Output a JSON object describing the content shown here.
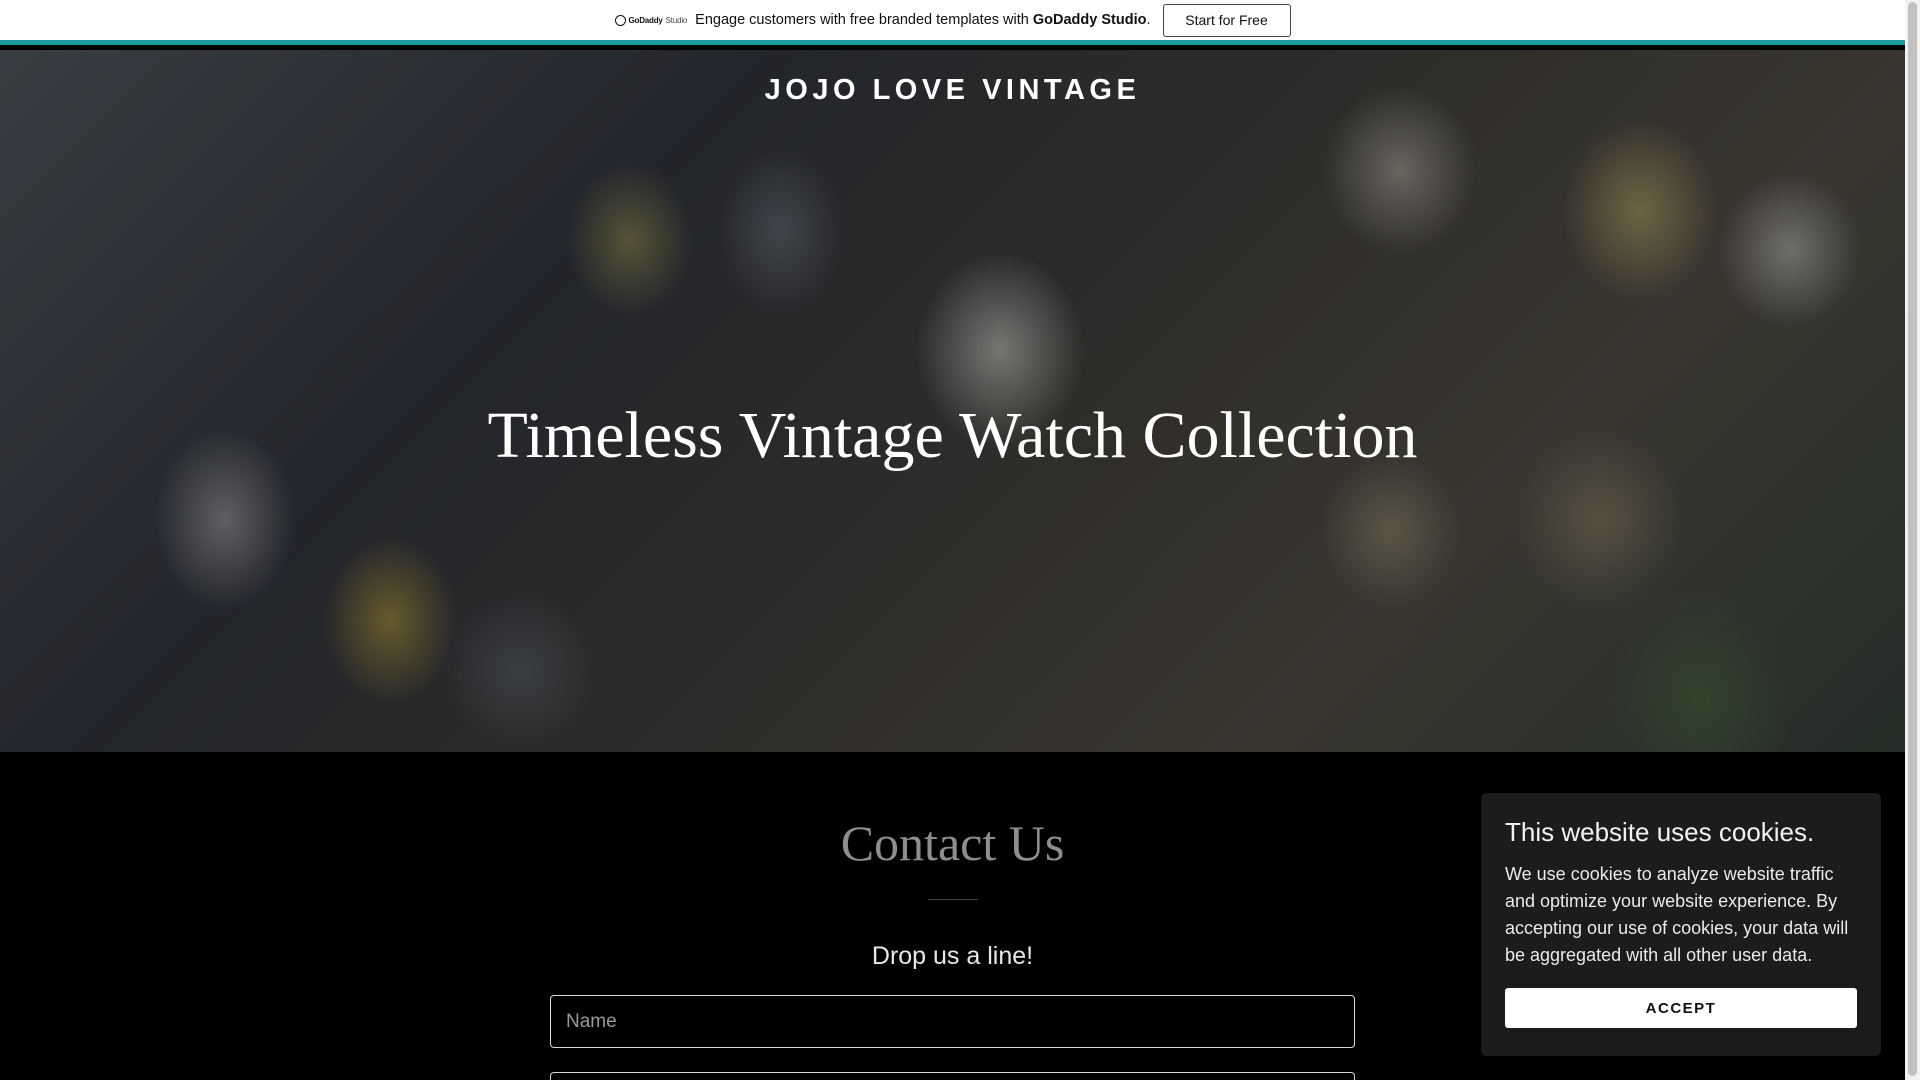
{
  "promo": {
    "logo_brand": "GoDaddy",
    "logo_product": "Studio",
    "text_prefix": "Engage customers with free branded templates with ",
    "text_brand": "GoDaddy Studio",
    "text_suffix": ".",
    "button_label": "Start for Free",
    "accent_color": "#1b9aa0"
  },
  "hero": {
    "site_title": "JOJO LOVE VINTAGE",
    "heading": "Timeless Vintage Watch Collection"
  },
  "contact": {
    "title": "Contact Us",
    "subtitle": "Drop us a line!",
    "name_placeholder": "Name",
    "email_placeholder": ""
  },
  "cookie": {
    "title": "This website uses cookies.",
    "body": "We use cookies to analyze website traffic and optimize your website experience. By accepting our use of cookies, your data will be aggregated with all other user data.",
    "button_label": "ACCEPT"
  }
}
